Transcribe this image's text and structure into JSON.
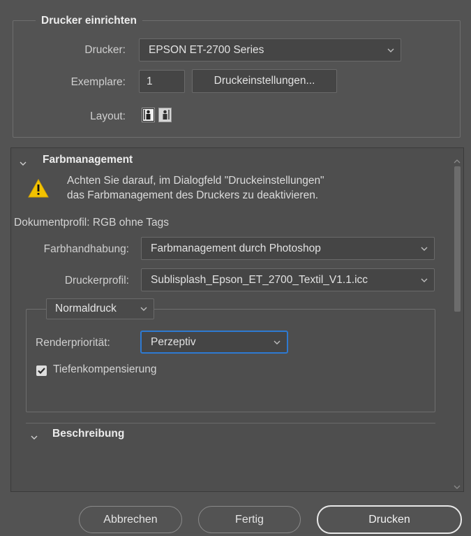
{
  "setup": {
    "legend": "Drucker einrichten",
    "printer_label": "Drucker:",
    "printer_value": "EPSON ET-2700 Series",
    "copies_label": "Exemplare:",
    "copies_value": "1",
    "print_settings_button": "Druckeinstellungen...",
    "layout_label": "Layout:",
    "layout_icons": [
      "portrait-layout-icon",
      "landscape-layout-icon"
    ]
  },
  "color_management": {
    "title": "Farbmanagement",
    "warning_line1": "Achten Sie darauf, im Dialogfeld \"Druckeinstellungen\"",
    "warning_line2": "das Farbmanagement des Druckers zu deaktivieren.",
    "document_profile": "Dokumentprofil: RGB ohne Tags",
    "color_handling_label": "Farbhandhabung:",
    "color_handling_value": "Farbmanagement durch Photoshop",
    "printer_profile_label": "Druckerprofil:",
    "printer_profile_value": "Sublisplash_Epson_ET_2700_Textil_V1.1.icc",
    "print_mode_value": "Normaldruck",
    "rendering_intent_label": "Renderpriorität:",
    "rendering_intent_value": "Perzeptiv",
    "black_point_label": "Tiefenkompensierung",
    "black_point_checked": true
  },
  "description": {
    "title": "Beschreibung"
  },
  "footer": {
    "cancel": "Abbrechen",
    "done": "Fertig",
    "print": "Drucken"
  },
  "colors": {
    "background": "#535353",
    "focus_ring": "#2e7ad1",
    "warning_yellow": "#f2c200"
  }
}
